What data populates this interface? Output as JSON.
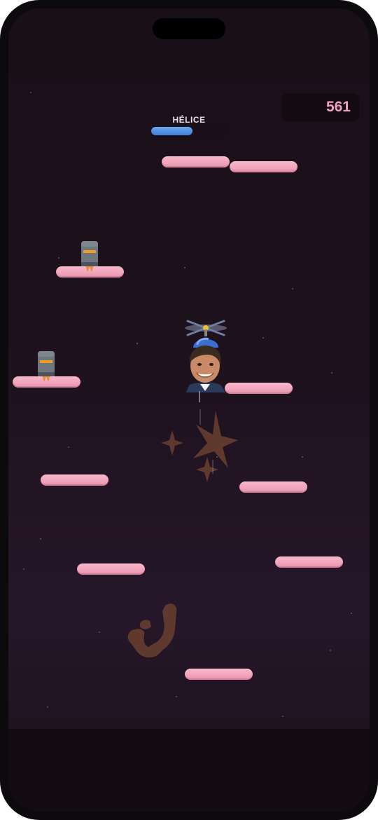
{
  "hud": {
    "score": "561",
    "powerup_label": "HÉLICE",
    "powerup_progress": 0.55
  },
  "player": {
    "powerup_icon": "propeller-hat-icon",
    "avatar": "player-face"
  },
  "items": [
    "jetpack-icon",
    "jetpack-icon"
  ],
  "colors": {
    "background_top": "#1a0f18",
    "background_bottom": "#26162a",
    "platform": "#f0a3ba",
    "score_text": "#f0a0c0",
    "powerup_bar": "#4a8ae0",
    "decor": "#6a4030"
  }
}
